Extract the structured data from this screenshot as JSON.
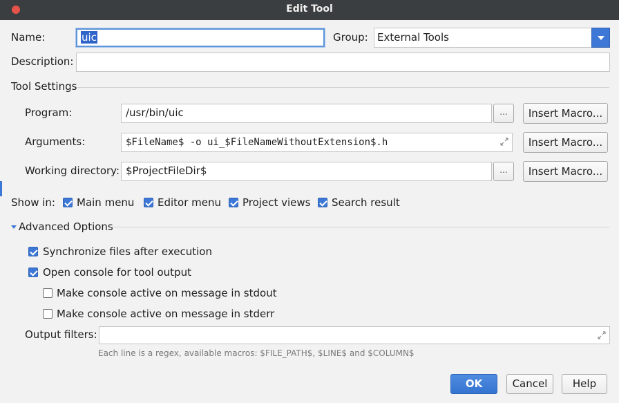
{
  "window": {
    "title": "Edit Tool"
  },
  "form": {
    "name_label": "Name:",
    "name_value": "uic",
    "group_label": "Group:",
    "group_value": "External Tools",
    "description_label": "Description:",
    "description_value": ""
  },
  "tool_settings": {
    "header": "Tool Settings",
    "program_label": "Program:",
    "program_value": "/usr/bin/uic",
    "arguments_label": "Arguments:",
    "arguments_value": "$FileName$ -o ui_$FileNameWithoutExtension$.h",
    "working_dir_label": "Working directory:",
    "working_dir_value": "$ProjectFileDir$",
    "browse_label": "...",
    "insert_macro_label": "Insert Macro..."
  },
  "show_in": {
    "label": "Show in:",
    "items": [
      {
        "label": "Main menu",
        "checked": true
      },
      {
        "label": "Editor menu",
        "checked": true
      },
      {
        "label": "Project views",
        "checked": true
      },
      {
        "label": "Search result",
        "checked": true
      }
    ]
  },
  "advanced": {
    "header": "Advanced Options",
    "sync_label": "Synchronize files after execution",
    "sync_checked": true,
    "console_label": "Open console for tool output",
    "console_checked": true,
    "stdout_label": "Make console active on message in stdout",
    "stdout_checked": false,
    "stderr_label": "Make console active on message in stderr",
    "stderr_checked": false,
    "output_filters_label": "Output filters:",
    "output_filters_value": "",
    "hint": "Each line is a regex, available macros: $FILE_PATH$, $LINE$ and $COLUMN$"
  },
  "buttons": {
    "ok": "OK",
    "cancel": "Cancel",
    "help": "Help"
  },
  "colors": {
    "accent": "#3d78d6",
    "close": "#e5534b",
    "titlebar": "#3b3e40"
  }
}
